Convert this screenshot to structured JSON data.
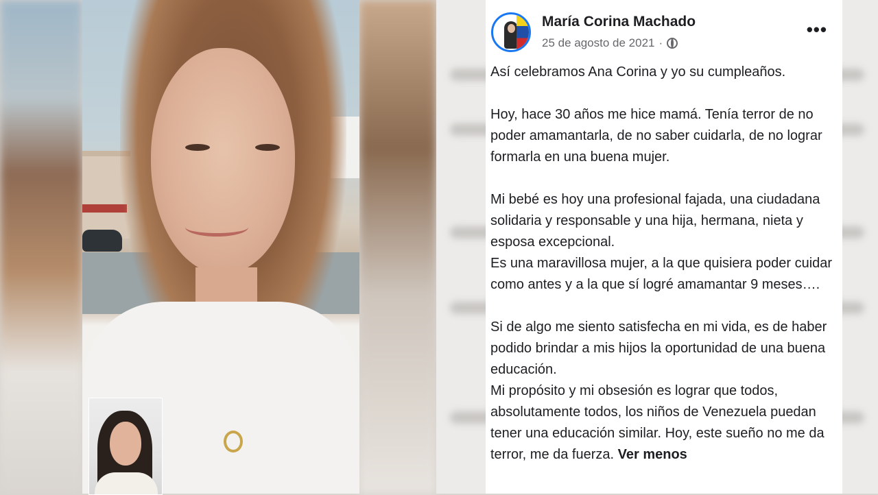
{
  "post": {
    "author": "María Corina Machado",
    "date": "25 de agosto de 2021",
    "date_sep": "·",
    "more_glyph": "•••",
    "paragraphs": [
      "Así celebramos Ana Corina y yo su cumpleaños.",
      "Hoy, hace 30 años me hice mamá. Tenía terror de no poder amamantarla, de no saber cuidarla, de no lograr formarla en una buena mujer.",
      "Mi bebé es hoy una profesional fajada, una ciudadana solidaria y responsable y una hija, hermana, nieta y esposa excepcional.",
      "Es una maravillosa mujer, a la que quisiera poder cuidar como antes y a la que sí logré amamantar 9 meses….",
      "Si de algo me siento satisfecha en mi vida, es de haber podido brindar a mis hijos la oportunidad de una buena educación.",
      "Mi propósito y mi obsesión es lograr que todos, absolutamente todos, los niños de Venezuela puedan tener una educación similar. Hoy, este sueño no me da terror, me da fuerza."
    ],
    "see_less": "Ver menos"
  },
  "colors": {
    "accent": "#1877f2",
    "text": "#1c1e21",
    "muted": "#65676b"
  }
}
